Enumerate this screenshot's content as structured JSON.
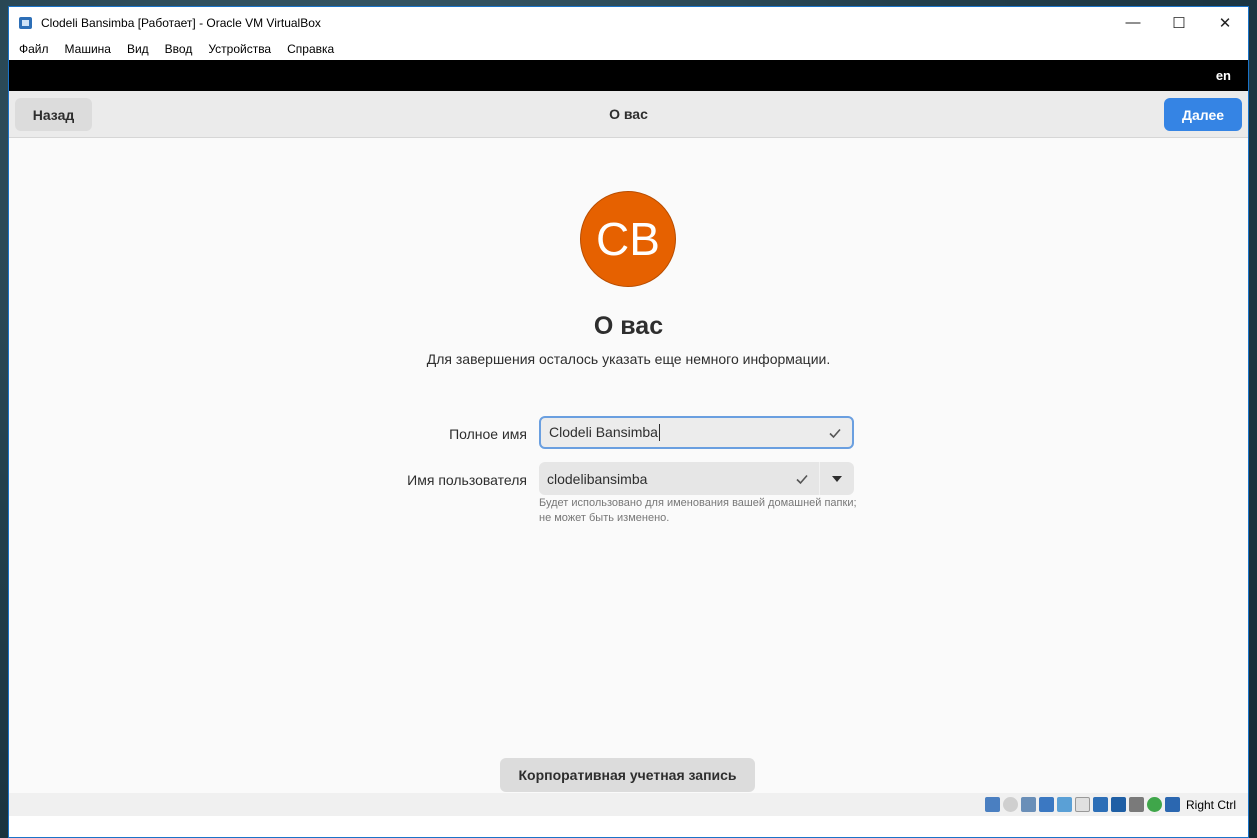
{
  "window": {
    "title": "Clodeli Bansimba [Работает] - Oracle VM VirtualBox",
    "minimize_glyph": "—",
    "maximize_glyph": "☐",
    "close_glyph": "✕"
  },
  "menu": {
    "items": [
      "Файл",
      "Машина",
      "Вид",
      "Ввод",
      "Устройства",
      "Справка"
    ]
  },
  "guest": {
    "keyboard_layout": "en",
    "header": {
      "back_label": "Назад",
      "title": "О вас",
      "next_label": "Далее"
    },
    "avatar": {
      "initials": "CB",
      "color": "#e66100"
    },
    "heading": "О вас",
    "subtitle": "Для завершения осталось указать еще немного информации.",
    "form": {
      "fullname_label": "Полное имя",
      "fullname_value": "Clodeli Bansimba",
      "username_label": "Имя пользователя",
      "username_value": "clodelibansimba",
      "username_hint": "Будет использовано для именования вашей домашней папки; не может быть изменено."
    },
    "enterprise_label": "Корпоративная учетная запись"
  },
  "statusbar": {
    "icons": [
      "hard-disk-icon",
      "optical-disk-icon",
      "audio-icon",
      "network-icon",
      "usb-icon",
      "shared-folder-icon",
      "display-icon",
      "video-capture-icon",
      "virtualization-icon",
      "guest-additions-icon",
      "mouse-integration-icon"
    ],
    "host_key": "Right Ctrl"
  },
  "colors": {
    "accent": "#3584e4",
    "avatar_bg": "#e66100",
    "window_border": "#1a73c8"
  }
}
